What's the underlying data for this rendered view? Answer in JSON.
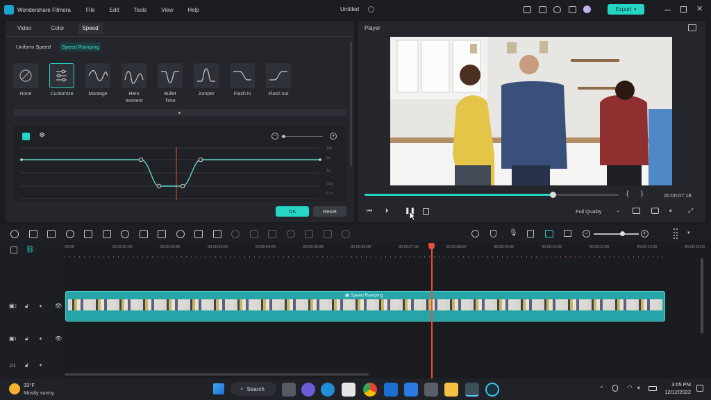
{
  "titlebar": {
    "app_name": "Wondershare Filmora",
    "menu": [
      "File",
      "Edit",
      "Tools",
      "View",
      "Help"
    ],
    "project": "Untitled",
    "export_label": "Export"
  },
  "left_panel": {
    "tabs": [
      "Video",
      "Color",
      "Speed"
    ],
    "active_tab": "Speed",
    "subtabs": [
      "Uniform Speed",
      "Speed Ramping"
    ],
    "active_subtab": "Speed Ramping",
    "presets": [
      {
        "label": "None"
      },
      {
        "label": "Customize"
      },
      {
        "label": "Montage"
      },
      {
        "label": "Hero moment"
      },
      {
        "label": "Bullet Time"
      },
      {
        "label": "Jumper"
      },
      {
        "label": "Flash in"
      },
      {
        "label": "Flash out"
      }
    ],
    "selected_preset": "Customize",
    "graph": {
      "y_ticks": [
        "10x",
        "5x",
        "1x",
        "0.5x",
        "0.1x"
      ]
    },
    "ok_label": "OK",
    "reset_label": "Reset"
  },
  "player": {
    "title": "Player",
    "timecode": "00:00:07:18",
    "quality": "Full Quality",
    "progress": 0.74
  },
  "timeline": {
    "ruler": [
      "00:00",
      "00:00:01:00",
      "00:00:02:00",
      "00:00:03:00",
      "00:00:04:00",
      "00:00:05:00",
      "00:00:06:00",
      "00:00:07:00",
      "00:00:08:00",
      "00:00:09:00",
      "00:00:10:00",
      "00:00:11:00",
      "00:00:12:00",
      "00:00:13:00"
    ],
    "clip_label": "Speed Ramping",
    "tracks": [
      "2",
      "1",
      "1"
    ]
  },
  "taskbar": {
    "temp": "33°F",
    "weather": "Mostly sunny",
    "search_label": "Search",
    "time": "3:05 PM",
    "date": "12/12/2022"
  },
  "colors": {
    "accent": "#24d6c6",
    "playhead": "#e8503a",
    "clip": "#27a4a7"
  }
}
